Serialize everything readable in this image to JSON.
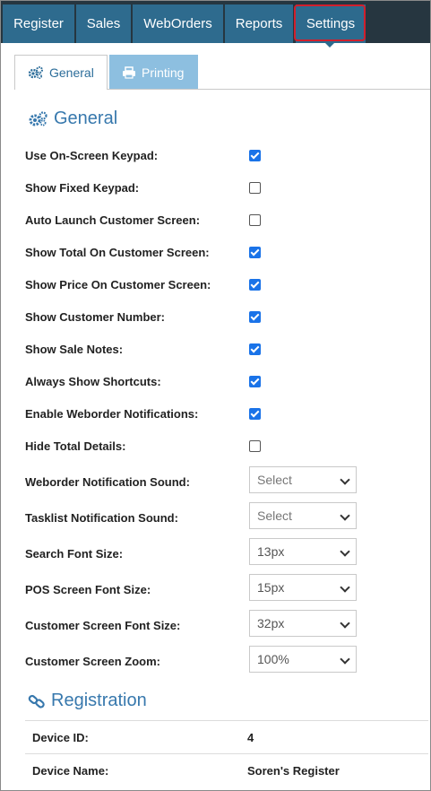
{
  "nav": {
    "tabs": [
      "Register",
      "Sales",
      "WebOrders",
      "Reports",
      "Settings"
    ],
    "active": "Settings"
  },
  "subtabs": {
    "general": {
      "label": "General",
      "icon": "gears-icon"
    },
    "printing": {
      "label": "Printing",
      "icon": "printer-icon"
    }
  },
  "sections": {
    "general_title": "General",
    "registration_title": "Registration"
  },
  "checkbox_settings": [
    {
      "label": "Use On-Screen Keypad:",
      "checked": true
    },
    {
      "label": "Show Fixed Keypad:",
      "checked": false
    },
    {
      "label": "Auto Launch Customer Screen:",
      "checked": false
    },
    {
      "label": "Show Total On Customer Screen:",
      "checked": true
    },
    {
      "label": "Show Price On Customer Screen:",
      "checked": true
    },
    {
      "label": "Show Customer Number:",
      "checked": true
    },
    {
      "label": "Show Sale Notes:",
      "checked": true
    },
    {
      "label": "Always Show Shortcuts:",
      "checked": true
    },
    {
      "label": "Enable Weborder Notifications:",
      "checked": true
    },
    {
      "label": "Hide Total Details:",
      "checked": false
    }
  ],
  "select_settings": [
    {
      "label": "Weborder Notification Sound:",
      "value": "Select"
    },
    {
      "label": "Tasklist Notification Sound:",
      "value": "Select"
    },
    {
      "label": "Search Font Size:",
      "value": "13px"
    },
    {
      "label": "POS Screen Font Size:",
      "value": "15px"
    },
    {
      "label": "Customer Screen Font Size:",
      "value": "32px"
    },
    {
      "label": "Customer Screen Zoom:",
      "value": "100%"
    }
  ],
  "registration": [
    {
      "key": "Device ID:",
      "value": "4"
    },
    {
      "key": "Device Name:",
      "value": "Soren's Register"
    }
  ],
  "colors": {
    "nav_bg": "#263640",
    "tab_bg": "#2e6b8e",
    "highlight": "#d11f2c",
    "accent": "#3778ad",
    "checkbox": "#1a73e8"
  }
}
